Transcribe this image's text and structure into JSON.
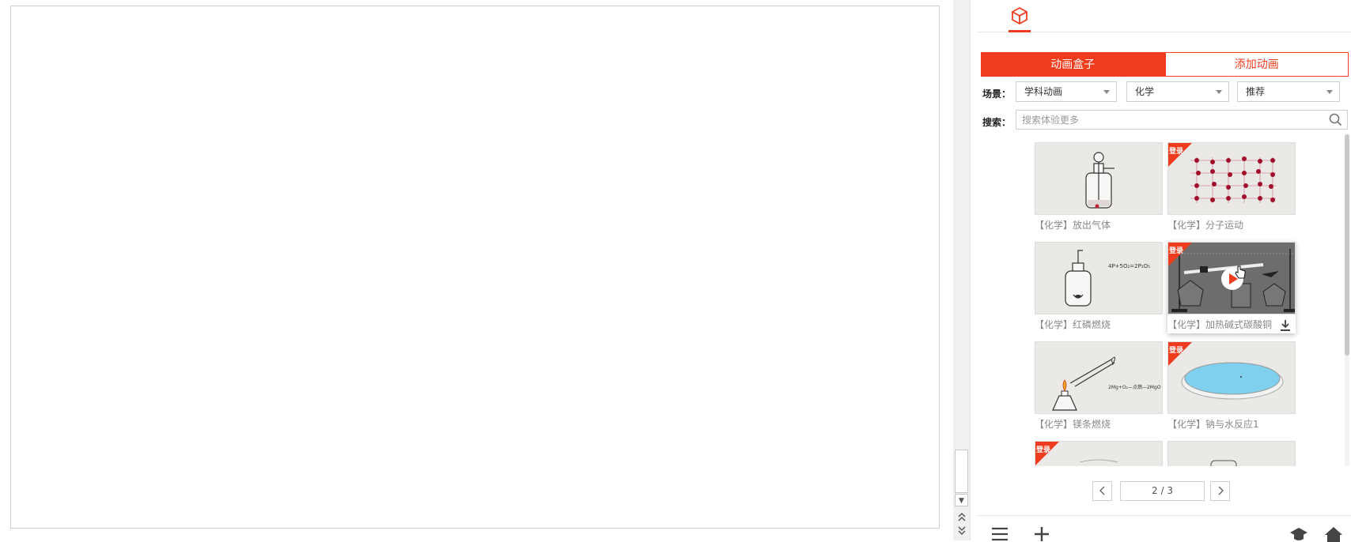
{
  "tabs": {
    "box_label": "动画盒子",
    "add_label": "添加动画"
  },
  "filters": {
    "scene_label": "场景：",
    "scene_value": "学科动画",
    "subject_value": "化学",
    "sort_value": "推荐"
  },
  "search": {
    "label": "搜索：",
    "placeholder": "搜索体验更多"
  },
  "cards": [
    {
      "caption": "【化学】放出气体",
      "login_badge": ""
    },
    {
      "caption": "【化学】分子运动",
      "login_badge": "登录"
    },
    {
      "caption": "【化学】红磷燃烧",
      "login_badge": ""
    },
    {
      "caption": "【化学】加热碱式碳酸铜",
      "login_badge": "登录"
    },
    {
      "caption": "【化学】镁条燃烧",
      "login_badge": ""
    },
    {
      "caption": "【化学】钠与水反应1",
      "login_badge": "登录"
    },
    {
      "caption": "",
      "login_badge": "登录"
    },
    {
      "caption": "",
      "login_badge": ""
    }
  ],
  "thumb_text": {
    "phosphorus_equation": "4P+5O₂=2P₂O₅",
    "magnesium_equation": "2Mg+O₂—点燃—2MgO"
  },
  "pager": {
    "page": "2 / 3"
  },
  "colors": {
    "accent": "#f23c1e",
    "water": "#7fd0ee"
  }
}
